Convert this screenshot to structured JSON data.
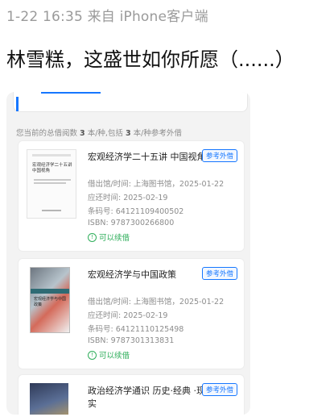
{
  "post": {
    "meta": "1-22 16:35 来自 iPhone客户端",
    "text": "林雪糕，这盛世如你所愿（......）"
  },
  "library": {
    "summary_prefix": "您当前的总借阅数",
    "summary_count": "3",
    "summary_mid": "本/种,包括",
    "summary_ref_count": "3",
    "summary_suffix": "本/种参考外借",
    "books": [
      {
        "title": "宏观经济学二十五讲 中国视角",
        "tag": "参考外借",
        "borrow": "借出馆/时间: 上海图书馆，2025-01-22",
        "due": "应还时间: 2025-02-19",
        "barcode": "条码号: 64121109400502",
        "isbn": "ISBN: 9787300266800",
        "renew": "可以续借",
        "cover_title": "宏观经济学二十五讲 中国视角"
      },
      {
        "title": "宏观经济学与中国政策",
        "tag": "参考外借",
        "borrow": "借出馆/时间: 上海图书馆，2025-01-22",
        "due": "应还时间: 2025-02-19",
        "barcode": "条码号: 64121110125498",
        "isbn": "ISBN: 9787301313831",
        "renew": "可以续借",
        "cover_title": "宏观经济学与中国政策"
      },
      {
        "title": "政治经济学通识 历史·经典 ·现实",
        "tag": "参考外借"
      }
    ]
  },
  "colors": {
    "accent": "#1677ff",
    "renew": "#2fae5b"
  }
}
